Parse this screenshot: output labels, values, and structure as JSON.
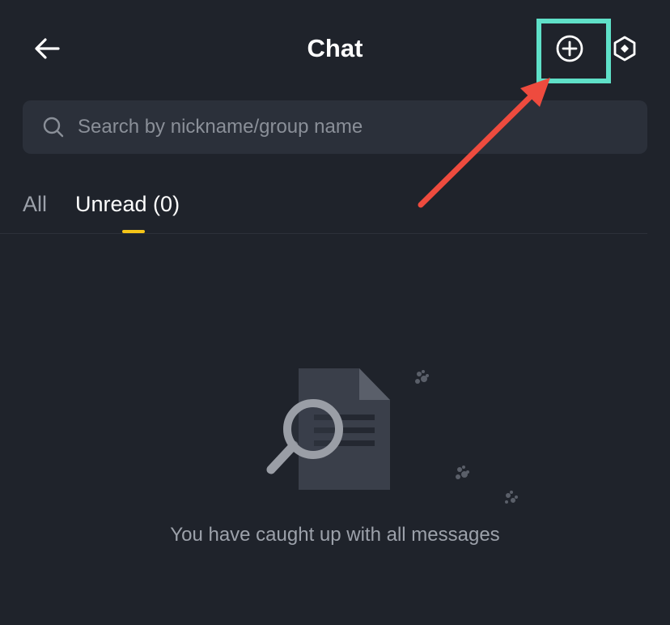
{
  "header": {
    "title": "Chat",
    "back_icon": "arrow-left-icon",
    "add_icon": "plus-circle-icon",
    "settings_icon": "settings-hexagon-icon"
  },
  "search": {
    "placeholder": "Search by nickname/group name",
    "icon": "search-icon"
  },
  "tabs": [
    {
      "label": "All",
      "active": false
    },
    {
      "label": "Unread (0)",
      "active": true
    }
  ],
  "empty_state": {
    "message": "You have caught up with all messages",
    "icon": "document-search-icon"
  },
  "annotation": {
    "highlight_color": "#5fe0c8",
    "arrow_color": "#ee4b3e"
  },
  "colors": {
    "background": "#1f232b",
    "search_bg": "#2b303a",
    "tab_indicator": "#f5c518"
  }
}
